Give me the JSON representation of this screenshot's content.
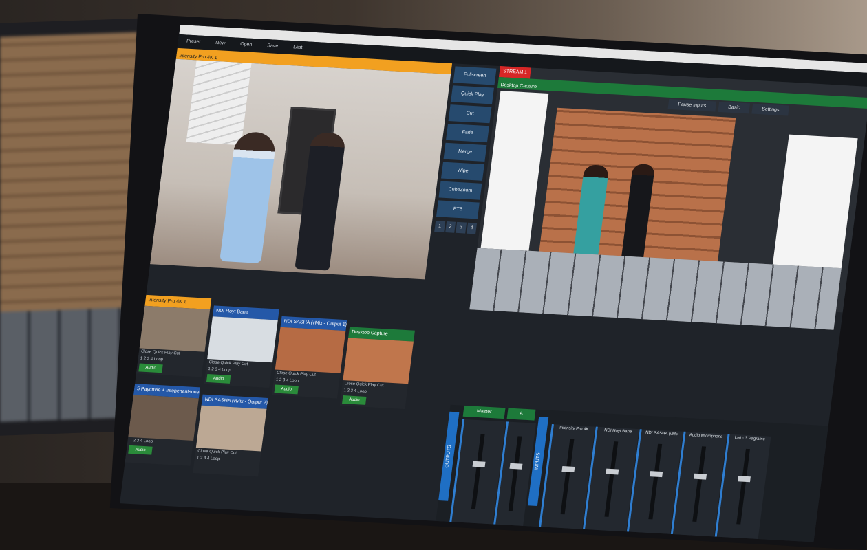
{
  "menu": [
    "Preset",
    "New",
    "Open",
    "Save",
    "Last"
  ],
  "preview": {
    "title": "Intensity Pro 4K 1"
  },
  "transitions": {
    "fullscreen": "Fullscreen",
    "buttons": [
      "Quick Play",
      "Cut",
      "Fade",
      "Merge",
      "Wipe",
      "CubeZoom",
      "FTB"
    ],
    "numbers": [
      "1",
      "2",
      "3",
      "4"
    ]
  },
  "output": {
    "stream": "STREAM 1",
    "title": "Desktop Capture",
    "buttons": [
      "Pause Inputs",
      "Basic",
      "Settings"
    ]
  },
  "inputs": [
    {
      "num": "1",
      "title": "Intensity Pro 4K 1",
      "color": "#f2a020"
    },
    {
      "num": "2",
      "title": "NDI Hoyt Bane",
      "color": "#2458a8"
    },
    {
      "num": "3",
      "title": "NDI SASHA (vMix - Output 1)",
      "color": "#2458a8"
    },
    {
      "num": "4",
      "title": "Desktop Capture",
      "color": "#1d7a3a"
    },
    {
      "num": "6",
      "title": "5 Paycnvie + Intepenantsone",
      "color": "#2458a8"
    },
    {
      "num": "7",
      "title": "NDI SASHA (vMix - Output 2)",
      "color": "#2458a8"
    }
  ],
  "input_controls": {
    "row1": "Close Quick Play Cut",
    "row2": "1 2 3 4 Loop",
    "audio": "Audio"
  },
  "side_label": "Audio Microphone",
  "mixer": {
    "outputs_label": "OUTPUTS",
    "inputs_label": "INPUTS",
    "master": "Master",
    "a": "A",
    "channels": [
      "Intensity Pro 4K",
      "NDI Hoyt Bane",
      "NDI SASHA (vMix",
      "Audio Microphone",
      "List - 3 Pagrame"
    ],
    "bottom_label": "NDI SASHA (vMix",
    "list_label": "List",
    "audio_label": "Audio Micro"
  }
}
